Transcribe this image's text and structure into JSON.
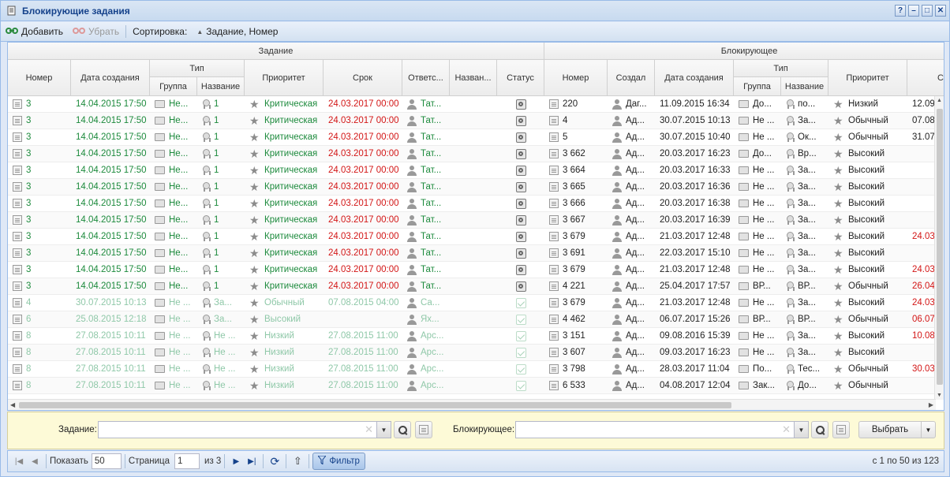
{
  "window": {
    "title": "Блокирующие задания",
    "buttons": [
      "?",
      "–",
      "□",
      "✕"
    ]
  },
  "toolbar": {
    "add_label": "Добавить",
    "remove_label": "Убрать",
    "sort_label": "Сортировка:",
    "sort_value": "Задание, Номер"
  },
  "grid": {
    "group_task": "Задание",
    "group_blocking": "Блокирующее",
    "headers": {
      "number": "Номер",
      "created": "Дата создания",
      "type": "Тип",
      "type_group": "Группа",
      "type_name": "Название",
      "priority": "Приоритет",
      "deadline": "Срок",
      "responsible": "Ответс...",
      "name": "Назван...",
      "status": "Статус",
      "b_number": "Номер",
      "b_creator": "Создал",
      "b_created": "Дата создания",
      "b_type": "Тип",
      "b_type_group": "Группа",
      "b_type_name": "Название",
      "b_priority": "Приоритет",
      "b_deadline": "Ср"
    },
    "rows": [
      {
        "num": "3",
        "created": "14.04.2015 17:50",
        "tgroup": "Не...",
        "tname": "1",
        "prio": "Критическая",
        "deadline": "24.03.2017 00:00",
        "resp": "Тат...",
        "status": "gear",
        "b_num": "220",
        "b_creator": "Даг...",
        "b_created": "11.09.2015 16:34",
        "b_tgroup": "До...",
        "b_tname": "по...",
        "b_prio": "Низкий",
        "b_deadline": "12.09",
        "state": "active",
        "b_deadline_color": "dark"
      },
      {
        "num": "3",
        "created": "14.04.2015 17:50",
        "tgroup": "Не...",
        "tname": "1",
        "prio": "Критическая",
        "deadline": "24.03.2017 00:00",
        "resp": "Тат...",
        "status": "gear",
        "b_num": "4",
        "b_creator": "Ад...",
        "b_created": "30.07.2015 10:13",
        "b_tgroup": "Не ...",
        "b_tname": "За...",
        "b_prio": "Обычный",
        "b_deadline": "07.08",
        "state": "active",
        "b_deadline_color": "dark"
      },
      {
        "num": "3",
        "created": "14.04.2015 17:50",
        "tgroup": "Не...",
        "tname": "1",
        "prio": "Критическая",
        "deadline": "24.03.2017 00:00",
        "resp": "Тат...",
        "status": "gear",
        "b_num": "5",
        "b_creator": "Ад...",
        "b_created": "30.07.2015 10:40",
        "b_tgroup": "Не ...",
        "b_tname": "Ок...",
        "b_prio": "Обычный",
        "b_deadline": "31.07",
        "state": "active",
        "b_deadline_color": "dark"
      },
      {
        "num": "3",
        "created": "14.04.2015 17:50",
        "tgroup": "Не...",
        "tname": "1",
        "prio": "Критическая",
        "deadline": "24.03.2017 00:00",
        "resp": "Тат...",
        "status": "gear",
        "b_num": "3 662",
        "b_creator": "Ад...",
        "b_created": "20.03.2017 16:23",
        "b_tgroup": "До...",
        "b_tname": "Вр...",
        "b_prio": "Высокий",
        "b_deadline": "",
        "state": "active",
        "b_deadline_color": "dark"
      },
      {
        "num": "3",
        "created": "14.04.2015 17:50",
        "tgroup": "Не...",
        "tname": "1",
        "prio": "Критическая",
        "deadline": "24.03.2017 00:00",
        "resp": "Тат...",
        "status": "gear",
        "b_num": "3 664",
        "b_creator": "Ад...",
        "b_created": "20.03.2017 16:33",
        "b_tgroup": "Не ...",
        "b_tname": "За...",
        "b_prio": "Высокий",
        "b_deadline": "",
        "state": "active",
        "b_deadline_color": "dark"
      },
      {
        "num": "3",
        "created": "14.04.2015 17:50",
        "tgroup": "Не...",
        "tname": "1",
        "prio": "Критическая",
        "deadline": "24.03.2017 00:00",
        "resp": "Тат...",
        "status": "gear",
        "b_num": "3 665",
        "b_creator": "Ад...",
        "b_created": "20.03.2017 16:36",
        "b_tgroup": "Не ...",
        "b_tname": "За...",
        "b_prio": "Высокий",
        "b_deadline": "",
        "state": "active",
        "b_deadline_color": "dark"
      },
      {
        "num": "3",
        "created": "14.04.2015 17:50",
        "tgroup": "Не...",
        "tname": "1",
        "prio": "Критическая",
        "deadline": "24.03.2017 00:00",
        "resp": "Тат...",
        "status": "gear",
        "b_num": "3 666",
        "b_creator": "Ад...",
        "b_created": "20.03.2017 16:38",
        "b_tgroup": "Не ...",
        "b_tname": "За...",
        "b_prio": "Высокий",
        "b_deadline": "",
        "state": "active",
        "b_deadline_color": "dark"
      },
      {
        "num": "3",
        "created": "14.04.2015 17:50",
        "tgroup": "Не...",
        "tname": "1",
        "prio": "Критическая",
        "deadline": "24.03.2017 00:00",
        "resp": "Тат...",
        "status": "gear",
        "b_num": "3 667",
        "b_creator": "Ад...",
        "b_created": "20.03.2017 16:39",
        "b_tgroup": "Не ...",
        "b_tname": "За...",
        "b_prio": "Высокий",
        "b_deadline": "",
        "state": "active",
        "b_deadline_color": "dark"
      },
      {
        "num": "3",
        "created": "14.04.2015 17:50",
        "tgroup": "Не...",
        "tname": "1",
        "prio": "Критическая",
        "deadline": "24.03.2017 00:00",
        "resp": "Тат...",
        "status": "gear",
        "b_num": "3 679",
        "b_creator": "Ад...",
        "b_created": "21.03.2017 12:48",
        "b_tgroup": "Не ...",
        "b_tname": "За...",
        "b_prio": "Высокий",
        "b_deadline": "24.03",
        "state": "active",
        "b_deadline_color": "red"
      },
      {
        "num": "3",
        "created": "14.04.2015 17:50",
        "tgroup": "Не...",
        "tname": "1",
        "prio": "Критическая",
        "deadline": "24.03.2017 00:00",
        "resp": "Тат...",
        "status": "gear",
        "b_num": "3 691",
        "b_creator": "Ад...",
        "b_created": "22.03.2017 15:10",
        "b_tgroup": "Не ...",
        "b_tname": "За...",
        "b_prio": "Высокий",
        "b_deadline": "",
        "state": "active",
        "b_deadline_color": "dark"
      },
      {
        "num": "3",
        "created": "14.04.2015 17:50",
        "tgroup": "Не...",
        "tname": "1",
        "prio": "Критическая",
        "deadline": "24.03.2017 00:00",
        "resp": "Тат...",
        "status": "gear",
        "b_num": "3 679",
        "b_creator": "Ад...",
        "b_created": "21.03.2017 12:48",
        "b_tgroup": "Не ...",
        "b_tname": "За...",
        "b_prio": "Высокий",
        "b_deadline": "24.03",
        "state": "active",
        "b_deadline_color": "red"
      },
      {
        "num": "3",
        "created": "14.04.2015 17:50",
        "tgroup": "Не...",
        "tname": "1",
        "prio": "Критическая",
        "deadline": "24.03.2017 00:00",
        "resp": "Тат...",
        "status": "gear",
        "b_num": "4 221",
        "b_creator": "Ад...",
        "b_created": "25.04.2017 17:57",
        "b_tgroup": "ВР...",
        "b_tname": "ВР...",
        "b_prio": "Обычный",
        "b_deadline": "26.04",
        "state": "active",
        "b_deadline_color": "red"
      },
      {
        "num": "4",
        "created": "30.07.2015 10:13",
        "tgroup": "Не ...",
        "tname": "За...",
        "prio": "Обычный",
        "deadline": "07.08.2015 04:00",
        "resp": "Са...",
        "status": "check",
        "b_num": "3 679",
        "b_creator": "Ад...",
        "b_created": "21.03.2017 12:48",
        "b_tgroup": "Не ...",
        "b_tname": "За...",
        "b_prio": "Высокий",
        "b_deadline": "24.03",
        "state": "done",
        "b_deadline_color": "red"
      },
      {
        "num": "6",
        "created": "25.08.2015 12:18",
        "tgroup": "Не ...",
        "tname": "За...",
        "prio": "Высокий",
        "deadline": "",
        "resp": "Ях...",
        "status": "check",
        "b_num": "4 462",
        "b_creator": "Ад...",
        "b_created": "06.07.2017 15:26",
        "b_tgroup": "ВР...",
        "b_tname": "ВР...",
        "b_prio": "Обычный",
        "b_deadline": "06.07",
        "state": "done",
        "b_deadline_color": "red"
      },
      {
        "num": "8",
        "created": "27.08.2015 10:11",
        "tgroup": "Не ...",
        "tname": "Не ...",
        "prio": "Низкий",
        "deadline": "27.08.2015 11:00",
        "resp": "Арс...",
        "status": "check",
        "b_num": "3 151",
        "b_creator": "Ад...",
        "b_created": "09.08.2016 15:39",
        "b_tgroup": "Не ...",
        "b_tname": "За...",
        "b_prio": "Высокий",
        "b_deadline": "10.08",
        "state": "done",
        "b_deadline_color": "red"
      },
      {
        "num": "8",
        "created": "27.08.2015 10:11",
        "tgroup": "Не ...",
        "tname": "Не ...",
        "prio": "Низкий",
        "deadline": "27.08.2015 11:00",
        "resp": "Арс...",
        "status": "check",
        "b_num": "3 607",
        "b_creator": "Ад...",
        "b_created": "09.03.2017 16:23",
        "b_tgroup": "Не ...",
        "b_tname": "За...",
        "b_prio": "Высокий",
        "b_deadline": "",
        "state": "done",
        "b_deadline_color": "dark"
      },
      {
        "num": "8",
        "created": "27.08.2015 10:11",
        "tgroup": "Не ...",
        "tname": "Не ...",
        "prio": "Низкий",
        "deadline": "27.08.2015 11:00",
        "resp": "Арс...",
        "status": "check",
        "b_num": "3 798",
        "b_creator": "Ад...",
        "b_created": "28.03.2017 11:04",
        "b_tgroup": "По...",
        "b_tname": "Тес...",
        "b_prio": "Обычный",
        "b_deadline": "30.03",
        "state": "done",
        "b_deadline_color": "red"
      },
      {
        "num": "8",
        "created": "27.08.2015 10:11",
        "tgroup": "Не ...",
        "tname": "Не ...",
        "prio": "Низкий",
        "deadline": "27.08.2015 11:00",
        "resp": "Арс...",
        "status": "check",
        "b_num": "6 533",
        "b_creator": "Ад...",
        "b_created": "04.08.2017 12:04",
        "b_tgroup": "Зак...",
        "b_tname": "До...",
        "b_prio": "Обычный",
        "b_deadline": "",
        "state": "done",
        "b_deadline_color": "dark"
      }
    ]
  },
  "filter": {
    "task_label": "Задание:",
    "task_value": "",
    "blocking_label": "Блокирующее:",
    "blocking_value": "",
    "select_label": "Выбрать"
  },
  "pager": {
    "show_label": "Показать",
    "page_size": "50",
    "page_label": "Страница",
    "page_value": "1",
    "of_label": "из 3",
    "filter_label": "Фильтр",
    "info": "с 1 по 50 из 123"
  },
  "colors": {
    "active_text": "#1c8a3c",
    "overdue": "#d31616",
    "done_text": "#8fc8a8",
    "filter_bg": "#fdfad7",
    "frame": "#99bbe8"
  }
}
